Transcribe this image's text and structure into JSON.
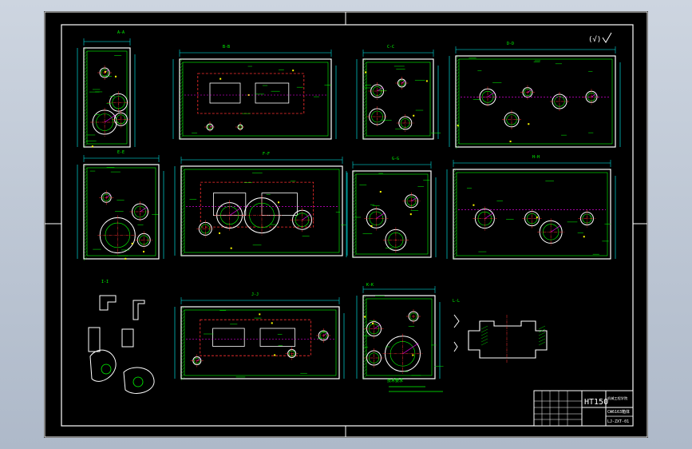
{
  "drawing": {
    "material": "HT150",
    "tech_note_label": "技术要求",
    "scale_left_label": "(√)",
    "view_labels": [
      "A-A",
      "B-B",
      "C-C",
      "D-D",
      "E-E",
      "F-F",
      "G-G",
      "H-H",
      "I-I",
      "J-J",
      "K-K",
      "L-L"
    ],
    "title_block": {
      "material": "HT150",
      "part_name": "CW6163箱体",
      "drawing_number": "LJ-ZXT-01",
      "school": "机械工程学院"
    },
    "colors": {
      "line": "#00ff00",
      "dim": "#00ffff",
      "section": "#ffffff",
      "hidden": "#ff3030",
      "accent": "#ff00ff",
      "yellow": "#ffff00"
    }
  }
}
